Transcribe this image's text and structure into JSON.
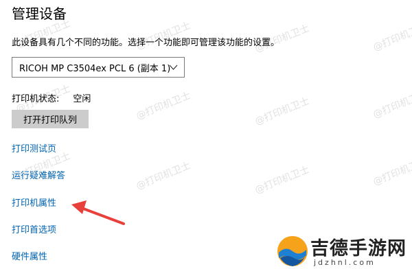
{
  "header": {
    "title": "管理设备"
  },
  "description": "此设备具有几个不同的功能。选择一个功能即可管理该功能的设置。",
  "device_select": {
    "value": "RICOH MP C3504ex PCL 6 (副本 1)"
  },
  "printer_status": {
    "label": "打印机状态:",
    "value": "空闲"
  },
  "open_queue_button": {
    "label": "打开打印队列"
  },
  "links": [
    {
      "label": "打印测试页"
    },
    {
      "label": "运行疑难解答"
    },
    {
      "label": "打印机属性"
    },
    {
      "label": "打印首选项"
    },
    {
      "label": "硬件属性"
    }
  ],
  "watermark": {
    "text": "@打印机卫士"
  },
  "logo": {
    "name": "吉德手游网",
    "domain": "jdzhnl.com"
  },
  "colors": {
    "link": "#0063b1",
    "button_bg": "#cccccc",
    "arrow": "#e8413c"
  }
}
